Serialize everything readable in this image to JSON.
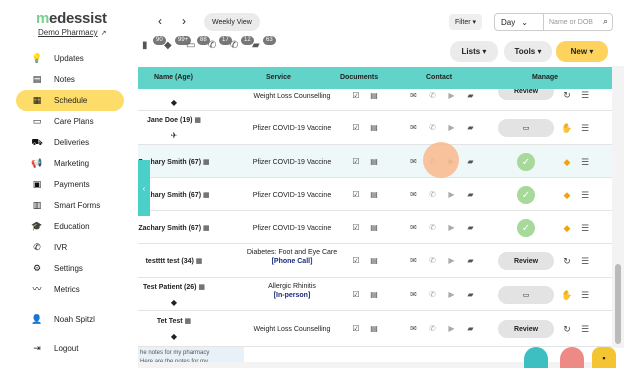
{
  "brand": {
    "logo_m": "m",
    "logo_rest": "edessist",
    "pharmacy": "Demo Pharmacy",
    "ext_icon": "↗"
  },
  "nav": [
    {
      "label": "Updates",
      "icon": "lightbulb-icon",
      "glyph": "💡"
    },
    {
      "label": "Notes",
      "icon": "notes-icon",
      "glyph": "▤"
    },
    {
      "label": "Schedule",
      "icon": "calendar-icon",
      "glyph": "▦",
      "active": true
    },
    {
      "label": "Care Plans",
      "icon": "care-plans-icon",
      "glyph": "▭"
    },
    {
      "label": "Deliveries",
      "icon": "truck-icon",
      "glyph": "⛟"
    },
    {
      "label": "Marketing",
      "icon": "megaphone-icon",
      "glyph": "📢"
    },
    {
      "label": "Payments",
      "icon": "payments-icon",
      "glyph": "▣"
    },
    {
      "label": "Smart Forms",
      "icon": "forms-icon",
      "glyph": "▥"
    },
    {
      "label": "Education",
      "icon": "graduation-icon",
      "glyph": "🎓"
    },
    {
      "label": "IVR",
      "icon": "phone-icon",
      "glyph": "✆"
    },
    {
      "label": "Settings",
      "icon": "gear-icon",
      "glyph": "⚙"
    },
    {
      "label": "Metrics",
      "icon": "metrics-icon",
      "glyph": "〰"
    }
  ],
  "user": {
    "name": "Noah Spitzl",
    "glyph": "👤"
  },
  "logout": {
    "label": "Logout",
    "glyph": "⇥"
  },
  "notes_panel": {
    "line1": "he notes for my pharmacy",
    "line2": "Here are the notes for my"
  },
  "toolbar": {
    "prev": "‹",
    "next": "›",
    "week_view": "Weekly View",
    "filter": "Filter ▾",
    "day_select": "Day",
    "day_caret": "⌄",
    "search_placeholder": "Name or DOB",
    "search_icon": "⌕",
    "lists": "Lists ▾",
    "tools": "Tools ▾",
    "new": "New ▾",
    "badges": [
      {
        "icon": "pill-bottle-icon",
        "glyph": "▮",
        "count": "90"
      },
      {
        "icon": "box-icon",
        "glyph": "◆",
        "count": "99+"
      },
      {
        "icon": "folder-icon",
        "glyph": "▭",
        "count": "88"
      },
      {
        "icon": "phone-icon",
        "glyph": "✆",
        "count": "17"
      },
      {
        "icon": "phone-forward-icon",
        "glyph": "✆",
        "count": "12"
      },
      {
        "icon": "chat-icon",
        "glyph": "▰",
        "count": "63"
      }
    ]
  },
  "table": {
    "headers": [
      "Name (Age)",
      "Service",
      "Documents",
      "Contact",
      "Manage"
    ],
    "rows": [
      {
        "name": "",
        "name_icon": "◆",
        "service": "Weight Loss Counselling",
        "tag": "",
        "manage": "Review",
        "status": "↻",
        "hl": false
      },
      {
        "name": "Jane Doe (19) ▦",
        "name_icon": "✈",
        "service": "Pfizer COVID-19 Vaccine",
        "tag": "",
        "manage": "doc",
        "status": "✋",
        "hl": false
      },
      {
        "name": "Zachary Smith (67) ▦",
        "name_icon": "",
        "service": "Pfizer COVID-19 Vaccine",
        "tag": "",
        "manage": "check",
        "status": "◆",
        "hl": true
      },
      {
        "name": "Zachary Smith (67) ▦",
        "name_icon": "",
        "service": "Pfizer COVID-19 Vaccine",
        "tag": "",
        "manage": "check",
        "status": "◆",
        "hl": false
      },
      {
        "name": "Zachary Smith (67) ▦",
        "name_icon": "",
        "service": "Pfizer COVID-19 Vaccine",
        "tag": "",
        "manage": "check",
        "status": "◆",
        "hl": false
      },
      {
        "name": "testttt test (34) ▦",
        "name_icon": "",
        "service": "Diabetes: Foot and Eye Care",
        "tag": "[Phone Call]",
        "manage": "Review",
        "status": "↻",
        "hl": false
      },
      {
        "name": "Test Patient (26) ▦",
        "name_icon": "◆",
        "service": "Allergic Rhinitis",
        "tag": "[In-person]",
        "manage": "doc",
        "status": "✋",
        "hl": false
      },
      {
        "name": "Tet Test ▦",
        "name_icon": "◆",
        "service": "Weight Loss Counselling",
        "tag": "",
        "manage": "Review",
        "status": "↻",
        "hl": false
      }
    ]
  },
  "icons": {
    "check": "✓",
    "doc": "▭",
    "list": "☰",
    "mail": "✉",
    "phone": "✆",
    "video": "▶",
    "chat": "▰",
    "docs1": "☑",
    "docs2": "▤",
    "toggle": "‹",
    "help": "▪"
  }
}
